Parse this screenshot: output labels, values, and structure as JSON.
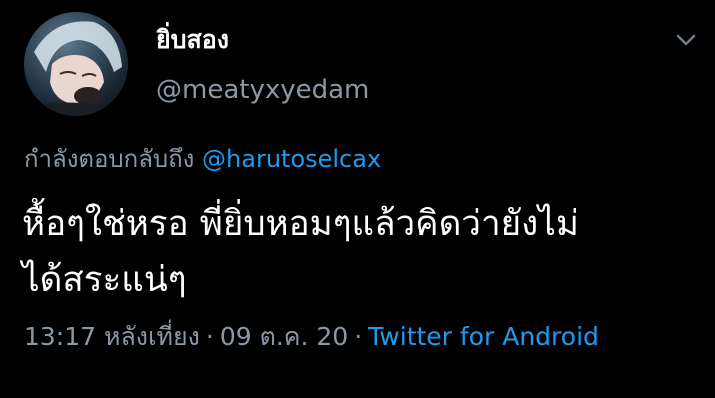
{
  "tweet": {
    "author": {
      "display_name": "ยิ่บสอง",
      "handle": "@meatyxyedam"
    },
    "reply": {
      "prefix": "กำลังตอบกลับถึง",
      "mention": "@harutoselcax"
    },
    "text_line_1": "หื้อๆใช่หรอ พี่ยิ่บหอมๆแล้วคิดว่ายังไม่",
    "text_line_2": "ได้สระแน่ๆ",
    "meta": {
      "time": "13:17 หลังเที่ยง",
      "separator": "·",
      "date": "09 ต.ค. 20",
      "source": "Twitter for Android"
    }
  },
  "icons": {
    "menu": "chevron-down-icon",
    "avatar": "avatar"
  },
  "colors": {
    "background": "#000000",
    "text_primary": "#ffffff",
    "text_secondary": "#8b98a5",
    "accent": "#1d9bf0"
  }
}
